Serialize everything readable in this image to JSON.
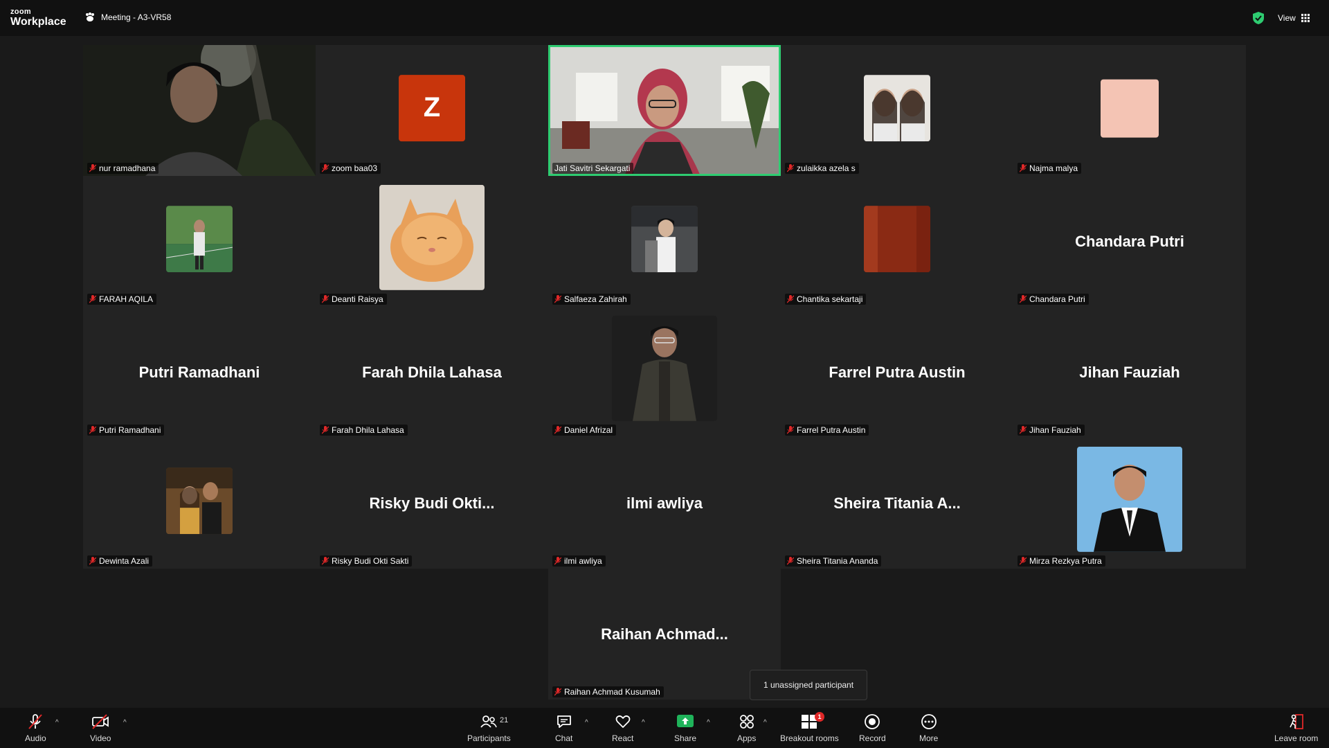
{
  "app": {
    "logo_small": "zoom",
    "logo_large": "Workplace",
    "meeting_title": "Meeting - A3-VR58",
    "view_label": "View"
  },
  "participants": [
    {
      "name": "nur ramadhana",
      "display": ""
    },
    {
      "name": "zoom baa03",
      "display": "",
      "avatar_letter": "Z"
    },
    {
      "name": "Jati Savitri Sekargati",
      "display": "",
      "active": true
    },
    {
      "name": "zulaikka azela s",
      "display": ""
    },
    {
      "name": "Najma malya",
      "display": ""
    },
    {
      "name": "FARAH AQILA",
      "display": ""
    },
    {
      "name": "Deanti Raisya",
      "display": ""
    },
    {
      "name": "Salfaeza Zahirah",
      "display": ""
    },
    {
      "name": "Chantika sekartaji",
      "display": ""
    },
    {
      "name": "Chandara Putri",
      "display": "Chandara Putri"
    },
    {
      "name": "Putri Ramadhani",
      "display": "Putri Ramadhani"
    },
    {
      "name": "Farah Dhila Lahasa",
      "display": "Farah Dhila Lahasa"
    },
    {
      "name": "Daniel Afrizal",
      "display": ""
    },
    {
      "name": "Farrel Putra Austin",
      "display": "Farrel Putra Austin"
    },
    {
      "name": "Jihan Fauziah",
      "display": "Jihan Fauziah"
    },
    {
      "name": "Dewinta Azali",
      "display": ""
    },
    {
      "name": "Risky Budi Okti Sakti",
      "display": "Risky  Budi  Okti..."
    },
    {
      "name": "ilmi awliya",
      "display": "ilmi awliya"
    },
    {
      "name": "Sheira Titania Ananda",
      "display": "Sheira  Titania  A..."
    },
    {
      "name": "Mirza Rezkya Putra",
      "display": ""
    },
    {
      "name": "Raihan Achmad Kusumah",
      "display": "Raihan  Achmad..."
    }
  ],
  "tooltip": "1 unassigned participant",
  "toolbar": {
    "audio": "Audio",
    "video": "Video",
    "participants": "Participants",
    "participants_count": "21",
    "chat": "Chat",
    "react": "React",
    "share": "Share",
    "apps": "Apps",
    "breakout": "Breakout rooms",
    "breakout_badge": "1",
    "record": "Record",
    "more": "More",
    "leave": "Leave room"
  },
  "colors": {
    "active_border": "#2ecc71",
    "share_green": "#1fb35a",
    "mute_red": "#e02828",
    "avatar_z": "#c8350c"
  }
}
